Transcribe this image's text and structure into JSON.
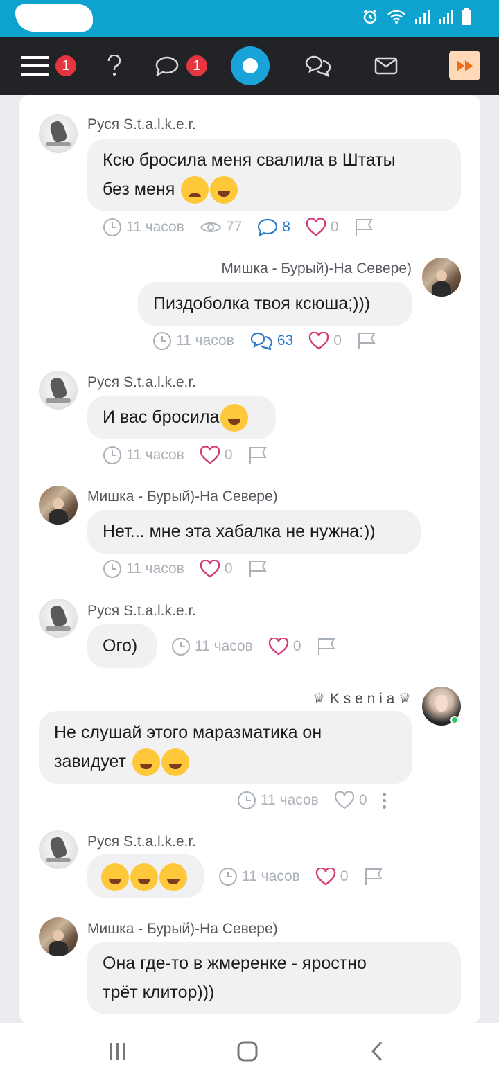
{
  "status_bar": {
    "icons": [
      "alarm-icon",
      "wifi-icon",
      "signal-icon",
      "signal-icon",
      "battery-icon"
    ]
  },
  "nav": {
    "menu_badge": "1",
    "chat_badge": "1",
    "icons": [
      "menu-icon",
      "question-icon",
      "chat-bubble-icon",
      "logo-icon",
      "chats-icon",
      "mail-icon",
      "fast-forward-icon"
    ]
  },
  "messages": [
    {
      "author": "Руся S.t.a.l.k.e.r.",
      "text_lines": [
        "Ксю бросила меня свалила в Штаты",
        "без меня"
      ],
      "emojis": [
        "sad-emoji",
        "laughing-emoji"
      ],
      "time": "11 часов",
      "views": "77",
      "replies": "8",
      "likes": "0"
    },
    {
      "author": "Мишка - Бурый)-На Севере)",
      "text": "Пиздоболка твоя ксюша;)))",
      "time": "11 часов",
      "replies": "63",
      "likes": "0"
    },
    {
      "author": "Руся S.t.a.l.k.e.r.",
      "text": "И вас бросила",
      "emojis": [
        "laughing-emoji"
      ],
      "time": "11 часов",
      "likes": "0"
    },
    {
      "author": "Мишка - Бурый)-На Севере)",
      "text": "Нет... мне эта хабалка не нужна:))",
      "time": "11 часов",
      "likes": "0"
    },
    {
      "author": "Руся S.t.a.l.k.e.r.",
      "text": "Ого)",
      "time": "11 часов",
      "likes": "0"
    },
    {
      "author": "♕ K s e n i a ♕",
      "text_lines": [
        "Не слушай этого маразматика он",
        "завидует"
      ],
      "emojis": [
        "winking-tongue-emoji",
        "rofl-emoji"
      ],
      "time": "11 часов",
      "likes": "0"
    },
    {
      "author": "Руся S.t.a.l.k.e.r.",
      "emojis": [
        "rofl-emoji",
        "rofl-emoji",
        "rofl-emoji"
      ],
      "time": "11 часов",
      "likes": "0"
    },
    {
      "author": "Мишка - Бурый)-На Севере)",
      "text_lines": [
        "Она где-то в жмеренке - яростно",
        "трёт клитор)))"
      ]
    }
  ],
  "colors": {
    "status_bar": "#0ea3cf",
    "nav_bar": "#212327",
    "badge": "#e5353f",
    "heart_pink": "#d43a78",
    "reply_blue": "#2d79c9",
    "bubble": "#f1f1f3"
  }
}
